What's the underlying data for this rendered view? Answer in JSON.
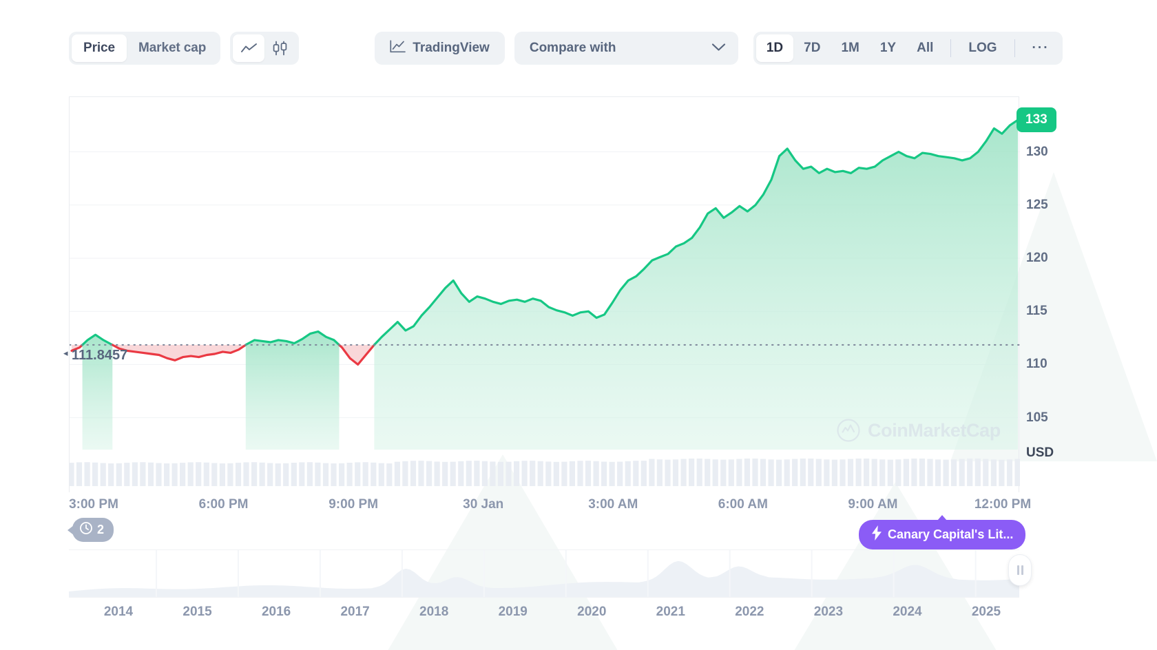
{
  "toolbar": {
    "metric_tabs": [
      {
        "label": "Price",
        "active": true
      },
      {
        "label": "Market cap",
        "active": false
      }
    ],
    "chart_type_icons": [
      {
        "name": "line-chart-icon",
        "active": true
      },
      {
        "name": "candlestick-chart-icon",
        "active": false
      }
    ],
    "tradingview_label": "TradingView",
    "compare_label": "Compare with",
    "ranges": [
      {
        "label": "1D",
        "active": true
      },
      {
        "label": "7D",
        "active": false
      },
      {
        "label": "1M",
        "active": false
      },
      {
        "label": "1Y",
        "active": false
      },
      {
        "label": "All",
        "active": false
      }
    ],
    "log_label": "LOG",
    "more_label": "···"
  },
  "chart_data": {
    "type": "area",
    "title": "",
    "xlabel": "",
    "ylabel": "USD",
    "currency": "USD",
    "ylim": [
      102,
      134.5
    ],
    "yticks": [
      130,
      125,
      120,
      115,
      110,
      105
    ],
    "current_price_badge": "133",
    "reference_price": "111.8457",
    "reference_price_value": 111.8457,
    "grid": true,
    "legend": "none",
    "colors": {
      "up_line": "#16c784",
      "up_fill": "#a9e7cd",
      "down_line": "#ea3943",
      "down_fill": "#f7c9cc",
      "badge": "#16c784",
      "news_badge": "#8b5cf6",
      "event_badge": "#a9b3c6",
      "axis_text": "#8c97ad"
    },
    "xticks": [
      "3:00 PM",
      "6:00 PM",
      "9:00 PM",
      "30 Jan",
      "3:00 AM",
      "6:00 AM",
      "9:00 AM",
      "12:00 PM"
    ],
    "x": [
      0,
      1,
      2,
      3,
      4,
      5,
      6,
      7,
      8,
      9,
      10,
      11,
      12,
      13,
      14,
      15,
      16,
      17,
      18,
      19,
      20,
      21,
      22,
      23,
      24,
      25,
      26,
      27,
      28,
      29,
      30,
      31,
      32,
      33,
      34,
      35,
      36,
      37,
      38,
      39,
      40,
      41,
      42,
      43,
      44,
      45,
      46,
      47,
      48,
      49,
      50,
      51,
      52,
      53,
      54,
      55,
      56,
      57,
      58,
      59,
      60,
      61,
      62,
      63,
      64,
      65,
      66,
      67,
      68,
      69,
      70,
      71,
      72,
      73,
      74,
      75,
      76,
      77,
      78,
      79,
      80,
      81,
      82,
      83,
      84,
      85,
      86,
      87,
      88,
      89,
      90,
      91,
      92,
      93,
      94,
      95,
      96,
      97,
      98,
      99,
      100,
      101,
      102,
      103,
      104,
      105,
      106,
      107,
      108,
      109,
      110,
      111,
      112,
      113,
      114,
      115,
      116,
      117,
      118,
      119
    ],
    "values": [
      111.3,
      111.6,
      112.3,
      112.8,
      112.3,
      111.9,
      111.5,
      111.3,
      111.2,
      111.1,
      111.0,
      110.9,
      110.6,
      110.4,
      110.7,
      110.8,
      110.7,
      110.9,
      111.0,
      111.2,
      111.1,
      111.4,
      111.9,
      112.3,
      112.2,
      112.1,
      112.3,
      112.2,
      112.0,
      112.4,
      112.9,
      113.1,
      112.6,
      112.3,
      111.6,
      110.6,
      110.0,
      110.9,
      111.8,
      112.6,
      113.3,
      114.0,
      113.2,
      113.6,
      114.6,
      115.4,
      116.3,
      117.2,
      117.9,
      116.7,
      115.9,
      116.4,
      116.2,
      115.9,
      115.7,
      116.0,
      116.1,
      115.9,
      116.2,
      116.0,
      115.4,
      115.1,
      114.9,
      114.6,
      114.9,
      115.0,
      114.4,
      114.7,
      115.8,
      117.0,
      117.9,
      118.3,
      119.0,
      119.8,
      120.1,
      120.4,
      121.1,
      121.4,
      121.9,
      122.9,
      124.2,
      124.7,
      123.8,
      124.3,
      124.9,
      124.4,
      125.0,
      126.0,
      127.4,
      129.6,
      130.3,
      129.2,
      128.4,
      128.6,
      128.0,
      128.4,
      128.1,
      128.2,
      128.0,
      128.5,
      128.4,
      128.6,
      129.2,
      129.6,
      130.0,
      129.6,
      129.4,
      129.9,
      129.8,
      129.6,
      129.5,
      129.4,
      129.2,
      129.4,
      130.0,
      131.0,
      132.2,
      131.7,
      132.5,
      133.0
    ],
    "volume_note": "volume bars at chart base",
    "navigator": {
      "years": [
        "2014",
        "2015",
        "2016",
        "2017",
        "2018",
        "2019",
        "2020",
        "2021",
        "2022",
        "2023",
        "2024",
        "2025"
      ],
      "handle_icon": "pause-handle-icon"
    },
    "annotations": [
      {
        "type": "event-count",
        "icon": "clock-icon",
        "label": "2",
        "position": "bottom-left"
      },
      {
        "type": "news",
        "icon": "lightning-icon",
        "label": "Canary Capital's Lit...",
        "position": "bottom-right"
      }
    ]
  },
  "watermark": {
    "text": "CoinMarketCap",
    "icon": "coinmarketcap-logo-icon"
  }
}
